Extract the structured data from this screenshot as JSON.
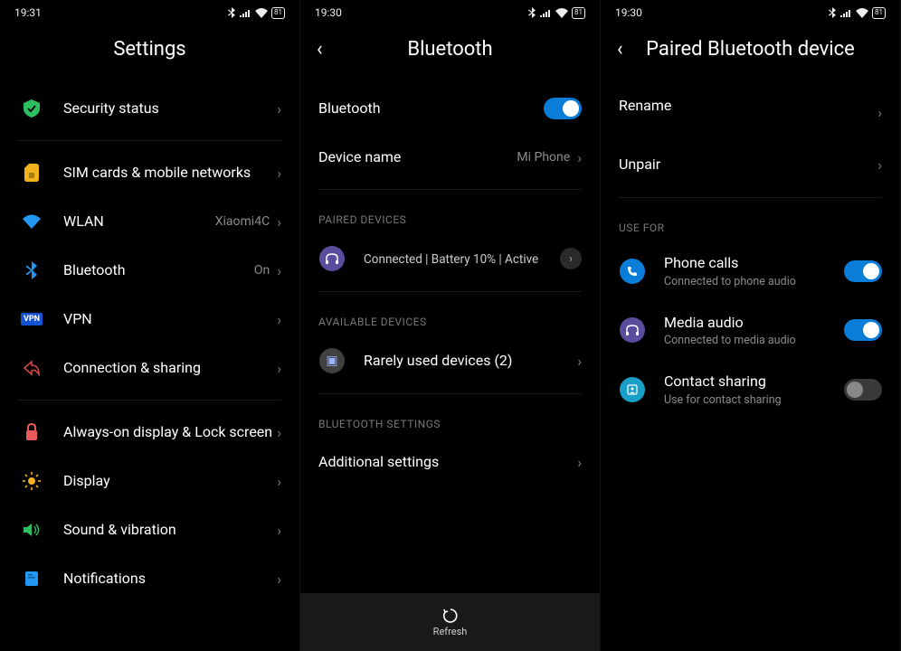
{
  "screens": [
    {
      "time": "19:31",
      "battery": "81",
      "title": "Settings",
      "hasBack": false,
      "items": [
        {
          "icon": "security",
          "iconClass": "ic-green",
          "label": "Security status"
        },
        {
          "divider": true
        },
        {
          "icon": "sim",
          "iconClass": "ic-yellow",
          "label": "SIM cards & mobile networks"
        },
        {
          "icon": "wifi",
          "iconClass": "ic-lblue",
          "label": "WLAN",
          "value": "Xiaomi4C"
        },
        {
          "icon": "bluetooth",
          "iconClass": "ic-lblue",
          "label": "Bluetooth",
          "value": "On"
        },
        {
          "icon": "vpn",
          "iconClass": "ic-dblue",
          "label": "VPN"
        },
        {
          "icon": "share",
          "iconClass": "ic-red",
          "label": "Connection & sharing"
        },
        {
          "divider": true
        },
        {
          "icon": "lock",
          "iconClass": "ic-pink",
          "label": "Always-on display & Lock screen"
        },
        {
          "icon": "brightness",
          "iconClass": "ic-orange",
          "label": "Display"
        },
        {
          "icon": "volume",
          "iconClass": "ic-teal",
          "label": "Sound & vibration"
        },
        {
          "icon": "notif",
          "iconClass": "ic-lblue",
          "label": "Notifications"
        }
      ]
    },
    {
      "time": "19:30",
      "battery": "81",
      "title": "Bluetooth",
      "hasBack": true,
      "rows": {
        "bluetooth_label": "Bluetooth",
        "device_name_label": "Device name",
        "device_name_value": "Mi Phone",
        "paired_header": "PAIRED DEVICES",
        "paired_status": "Connected | Battery 10% | Active",
        "available_header": "AVAILABLE DEVICES",
        "rarely_used_label": "Rarely used devices (2)",
        "settings_header": "BLUETOOTH SETTINGS",
        "additional_label": "Additional settings",
        "refresh_label": "Refresh"
      }
    },
    {
      "time": "19:30",
      "battery": "81",
      "title": "Paired Bluetooth device",
      "hasBack": true,
      "rows": {
        "rename_label": "Rename",
        "unpair_label": "Unpair",
        "use_for_header": "USE FOR",
        "phone_calls_label": "Phone calls",
        "phone_calls_sub": "Connected to phone audio",
        "media_audio_label": "Media audio",
        "media_audio_sub": "Connected to media audio",
        "contact_sharing_label": "Contact sharing",
        "contact_sharing_sub": "Use for contact sharing"
      }
    }
  ]
}
